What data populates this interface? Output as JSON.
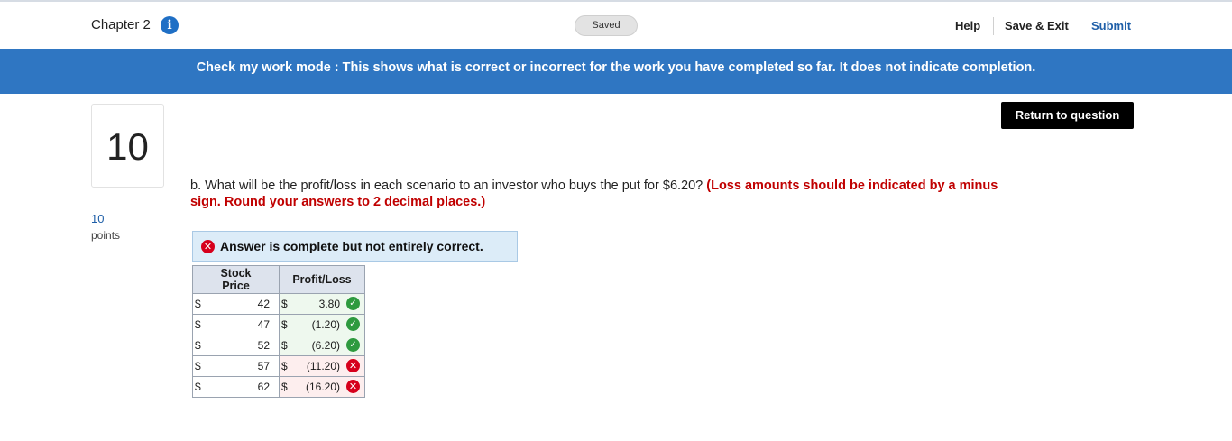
{
  "header": {
    "chapter": "Chapter 2",
    "info_icon": "info-icon",
    "saved": "Saved",
    "help": "Help",
    "save_exit": "Save & Exit",
    "submit": "Submit"
  },
  "banner": {
    "text": "Check my work mode : This shows what is correct or incorrect for the work you have completed so far. It does not indicate completion."
  },
  "question": {
    "number": "10",
    "points_value": "10",
    "points_label": "points",
    "return_button": "Return to question",
    "prompt": "b. What will be the profit/loss in each scenario to an investor who buys the put for $6.20?",
    "instruction": "(Loss amounts should be indicated by a minus sign. Round your answers to 2 decimal places.)"
  },
  "answer": {
    "status": "Answer is complete but not entirely correct.",
    "columns": [
      "Stock Price",
      "Profit/Loss"
    ],
    "rows": [
      {
        "currency": "$",
        "stock_price": "42",
        "pl_currency": "$",
        "profit_loss": "3.80",
        "correct": true
      },
      {
        "currency": "$",
        "stock_price": "47",
        "pl_currency": "$",
        "profit_loss": "(1.20)",
        "correct": true
      },
      {
        "currency": "$",
        "stock_price": "52",
        "pl_currency": "$",
        "profit_loss": "(6.20)",
        "correct": true
      },
      {
        "currency": "$",
        "stock_price": "57",
        "pl_currency": "$",
        "profit_loss": "(11.20)",
        "correct": false
      },
      {
        "currency": "$",
        "stock_price": "62",
        "pl_currency": "$",
        "profit_loss": "(16.20)",
        "correct": false
      }
    ]
  },
  "colors": {
    "accent_blue": "#2f76c2",
    "link_blue": "#1f5fa8",
    "error_red": "#d6001c",
    "success_green": "#2e9a3f",
    "instruction_red": "#c00000"
  }
}
